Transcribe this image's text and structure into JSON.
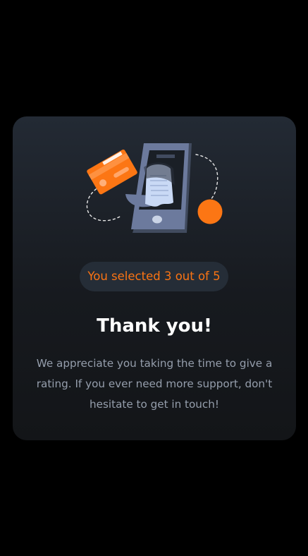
{
  "card": {
    "illustration": {
      "name": "thank-you-illustration",
      "accent_color": "#fc7614",
      "phone_color": "#6c7a9d",
      "receipt_color": "#c9d9f5"
    },
    "selection_text": "You selected 3 out of 5",
    "title": "Thank you!",
    "message": "We appreciate you taking the time to give a rating. If you ever need more support, don't hesitate to get in touch!"
  },
  "colors": {
    "background": "#000000",
    "card_top": "#232a34",
    "card_bottom": "#131518",
    "accent": "#fb7413",
    "pill_bg": "#252d37",
    "title": "#ffffff",
    "body_text": "#959eac"
  }
}
